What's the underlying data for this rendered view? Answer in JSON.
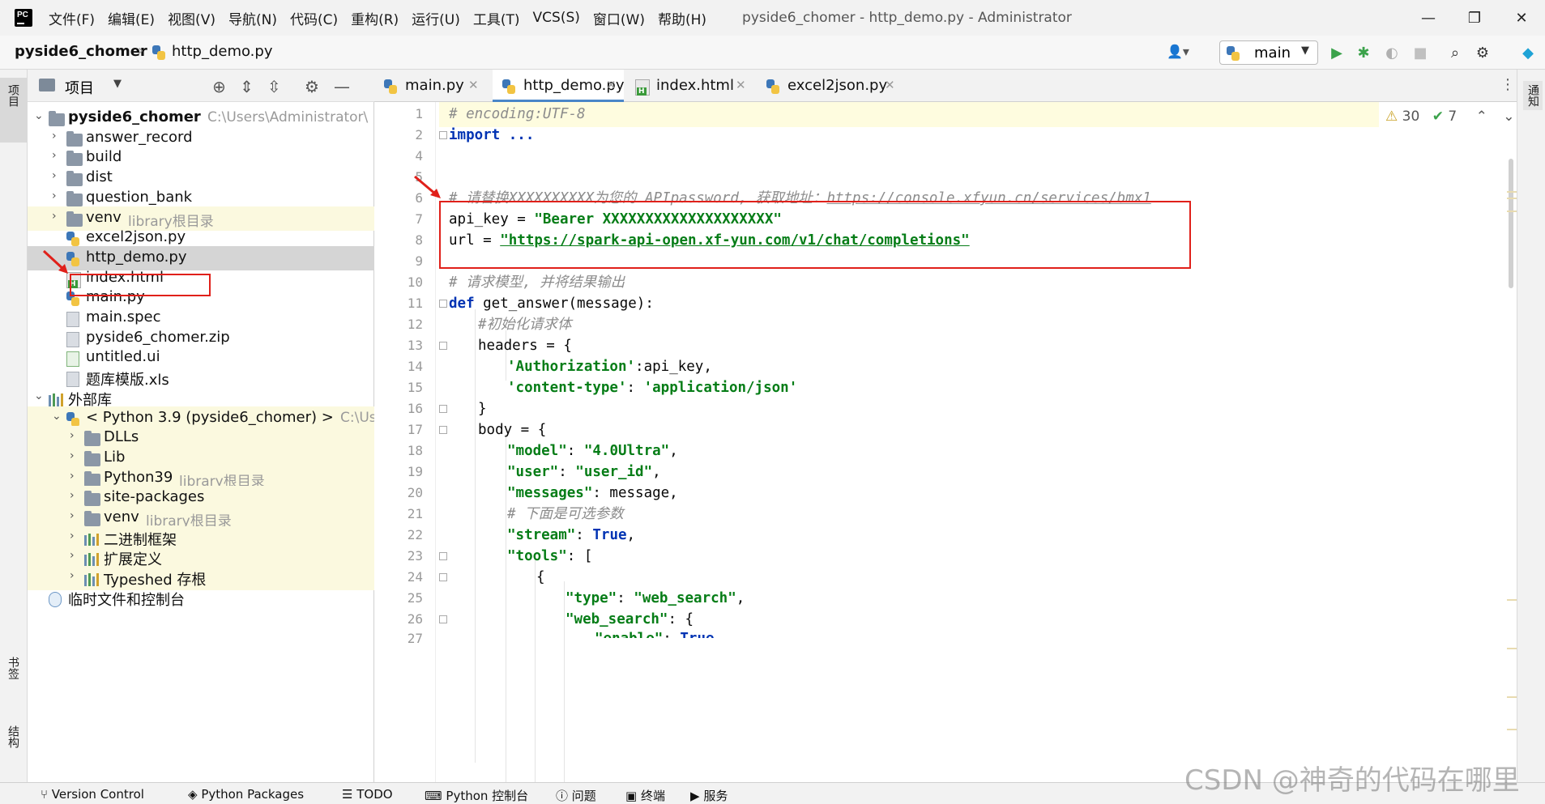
{
  "menubar": {
    "items": [
      "文件(F)",
      "编辑(E)",
      "视图(V)",
      "导航(N)",
      "代码(C)",
      "重构(R)",
      "运行(U)",
      "工具(T)",
      "VCS(S)",
      "窗口(W)",
      "帮助(H)"
    ],
    "window_title": "pyside6_chomer - http_demo.py - Administrator"
  },
  "navbar": {
    "project": "pyside6_chomer",
    "file": "http_demo.py",
    "run_config": "main"
  },
  "left_strip": {
    "project_tab": "项目",
    "bookmarks_tab": "书签",
    "structure_tab": "结构"
  },
  "right_strip": {
    "notifications_tab": "通知"
  },
  "project_panel": {
    "title": "项目",
    "tree": [
      {
        "label": "pyside6_chomer",
        "sub": "C:\\Users\\Administrator\\",
        "type": "root-folder"
      },
      {
        "label": "answer_record",
        "type": "folder"
      },
      {
        "label": "build",
        "type": "folder"
      },
      {
        "label": "dist",
        "type": "folder"
      },
      {
        "label": "question_bank",
        "type": "folder"
      },
      {
        "label": "venv",
        "sub": "library根目录",
        "type": "folder"
      },
      {
        "label": "excel2json.py",
        "type": "py"
      },
      {
        "label": "http_demo.py",
        "type": "py"
      },
      {
        "label": "index.html",
        "type": "html"
      },
      {
        "label": "main.py",
        "type": "py"
      },
      {
        "label": "main.spec",
        "type": "file"
      },
      {
        "label": "pyside6_chomer.zip",
        "type": "file"
      },
      {
        "label": "untitled.ui",
        "type": "ui"
      },
      {
        "label": "题库模版.xls",
        "type": "xls"
      },
      {
        "label": "外部库",
        "type": "lib"
      },
      {
        "label": "< Python 3.9 (pyside6_chomer) >",
        "sub": "C:\\Us",
        "type": "python"
      },
      {
        "label": "DLLs",
        "type": "folder"
      },
      {
        "label": "Lib",
        "type": "folder"
      },
      {
        "label": "Python39",
        "sub": "library根目录",
        "type": "folder"
      },
      {
        "label": "site-packages",
        "type": "folder"
      },
      {
        "label": "venv",
        "sub": "library根目录",
        "type": "folder"
      },
      {
        "label": "二进制框架",
        "type": "lib"
      },
      {
        "label": "扩展定义",
        "type": "lib"
      },
      {
        "label": "Typeshed 存根",
        "type": "lib"
      },
      {
        "label": "临时文件和控制台",
        "type": "scratch"
      }
    ]
  },
  "editor_tabs": [
    {
      "label": "main.py"
    },
    {
      "label": "http_demo.py"
    },
    {
      "label": "index.html"
    },
    {
      "label": "excel2json.py"
    }
  ],
  "inspections": {
    "warnings": "30",
    "ok": "7"
  },
  "code_lines": [
    "1",
    "2",
    "4",
    "5",
    "6",
    "7",
    "8",
    "9",
    "10",
    "11",
    "12",
    "13",
    "14",
    "15",
    "16",
    "17",
    "18",
    "19",
    "20",
    "21",
    "22",
    "23",
    "24",
    "25",
    "26",
    "27"
  ],
  "code": {
    "l1": "# encoding:UTF-8",
    "l2": "import ...",
    "l6": "# 请替换XXXXXXXXXX为您的 APIpassword, 获取地址：",
    "l6_url": "https://console.xfyun.cn/services/bmx1",
    "l7_a": "api_key = ",
    "l7_b": "\"Bearer XXXXXXXXXXXXXXXXXXXX\"",
    "l8_a": "url = ",
    "l8_b": "\"https://spark-api-open.xf-yun.com/v1/chat/completions\"",
    "l10": "# 请求模型, 并将结果输出",
    "l11_kw": "def",
    "l11_b": " get_answer(message):",
    "l12": "#初始化请求体",
    "l13": "headers = {",
    "l14_a": "'Authorization'",
    "l14_b": ":api_key,",
    "l15_a": "'content-type'",
    "l15_b": ": ",
    "l15_c": "'application/json'",
    "l16": "}",
    "l17": "body = {",
    "l18_a": "\"model\"",
    "l18_b": ": ",
    "l18_c": "\"4.0Ultra\"",
    "l18_d": ",",
    "l19_a": "\"user\"",
    "l19_b": ": ",
    "l19_c": "\"user_id\"",
    "l19_d": ",",
    "l20_a": "\"messages\"",
    "l20_b": ": message,",
    "l21": "# 下面是可选参数",
    "l22_a": "\"stream\"",
    "l22_b": ": ",
    "l22_c": "True",
    "l22_d": ",",
    "l23_a": "\"tools\"",
    "l23_b": ": [",
    "l24": "{",
    "l25_a": "\"type\"",
    "l25_b": ": ",
    "l25_c": "\"web_search\"",
    "l25_d": ",",
    "l26_a": "\"web_search\"",
    "l26_b": ": {",
    "l27_a": "\"enable\"",
    "l27_b": ": ",
    "l27_c": "True"
  },
  "bottom_bar": [
    "Version Control",
    "Python Packages",
    "TODO",
    "Python 控制台",
    "问题",
    "终端",
    "服务"
  ],
  "watermark": "CSDN @神奇的代码在哪里",
  "colors": {
    "highlight_red": "#e0201a",
    "accent": "#4a86c8"
  }
}
